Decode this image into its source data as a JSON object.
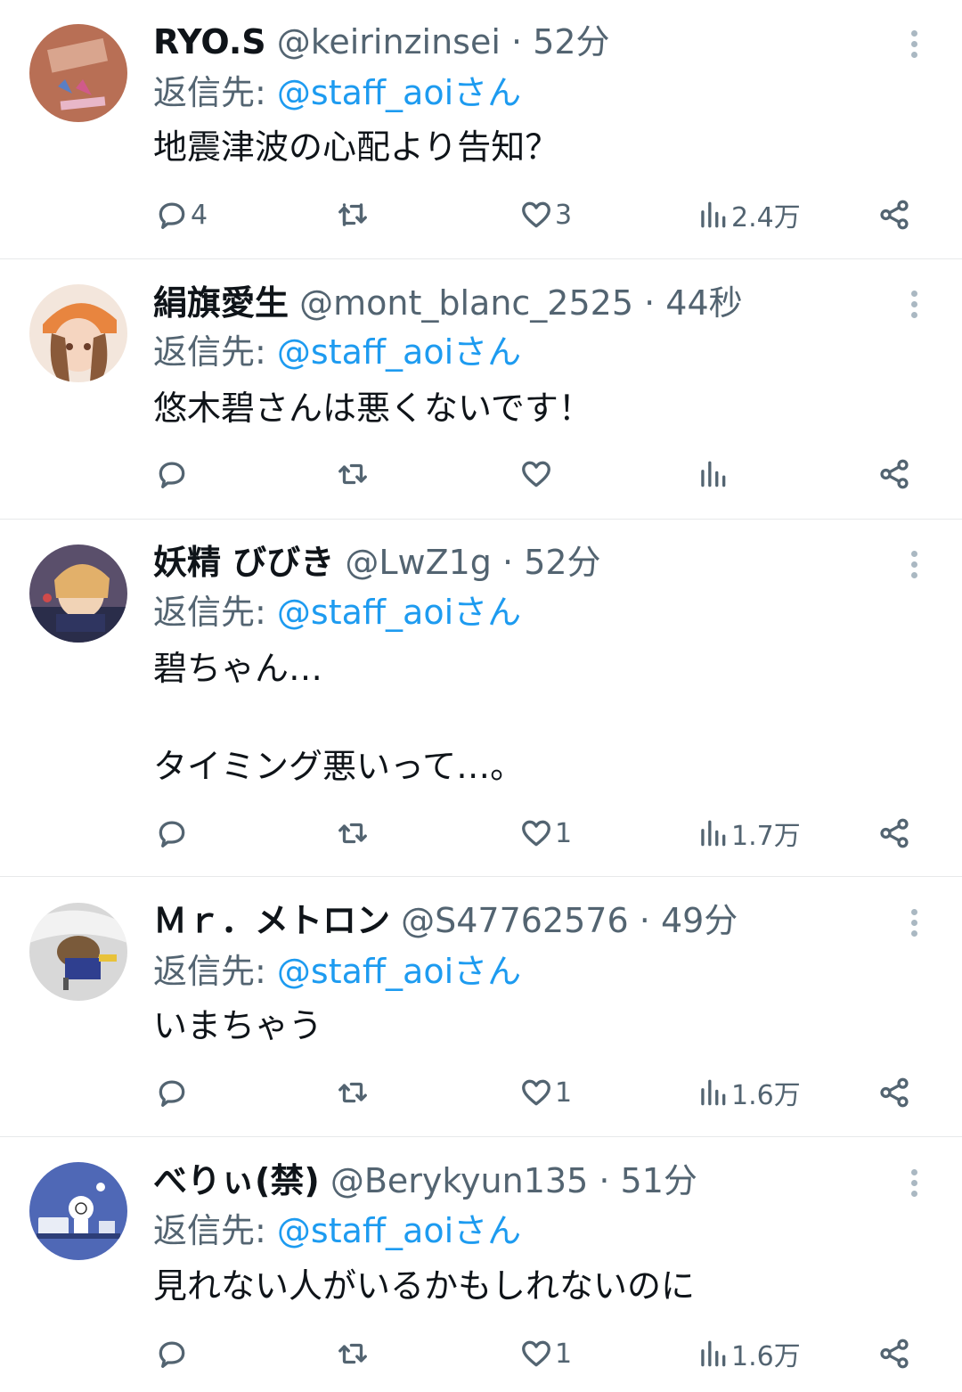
{
  "tweets": [
    {
      "name": "RYO.S",
      "handle": "@keirinzinsei",
      "time": "52分",
      "reply_prefix": "返信先: ",
      "reply_to": "@staff_aoiさん",
      "text": "地震津波の心配より告知？",
      "replies": "4",
      "retweets": "",
      "likes": "3",
      "views": "2.4万",
      "avatar_color": "#b86f55"
    },
    {
      "name": "絹旗愛生",
      "handle": "@mont_blanc_2525",
      "time": "44秒",
      "reply_prefix": "返信先: ",
      "reply_to": "@staff_aoiさん",
      "text": "悠木碧さんは悪くないです！",
      "replies": "",
      "retweets": "",
      "likes": "",
      "views": "",
      "avatar_color": "#e8853f"
    },
    {
      "name": "妖精 びびき",
      "handle": "@LwZ1g",
      "time": "52分",
      "reply_prefix": "返信先: ",
      "reply_to": "@staff_aoiさん",
      "text": "碧ちゃん…\n\nタイミング悪いって…。",
      "replies": "",
      "retweets": "",
      "likes": "1",
      "views": "1.7万",
      "avatar_color": "#5a4f6b"
    },
    {
      "name": "Ｍｒ．メトロン",
      "handle": "@S47762576",
      "time": "49分",
      "reply_prefix": "返信先: ",
      "reply_to": "@staff_aoiさん",
      "text": "いまちゃう",
      "replies": "",
      "retweets": "",
      "likes": "1",
      "views": "1.6万",
      "avatar_color": "#c9c9c9"
    },
    {
      "name": "べりぃ(禁)",
      "handle": "@Berykyun135",
      "time": "51分",
      "reply_prefix": "返信先: ",
      "reply_to": "@staff_aoiさん",
      "text": "見れない人がいるかもしれないのに",
      "replies": "",
      "retweets": "",
      "likes": "1",
      "views": "1.6万",
      "avatar_color": "#4f68b6"
    }
  ],
  "icons": {
    "reply": "speech-bubble-icon",
    "retweet": "retweet-arrows-icon",
    "like": "heart-icon",
    "views": "bar-chart-icon",
    "share": "share-nodes-icon",
    "more": "vertical-ellipsis-icon"
  },
  "colors": {
    "link": "#1d9bf0",
    "muted": "#536471",
    "text": "#0f1419",
    "divider": "#e7e9ea"
  }
}
